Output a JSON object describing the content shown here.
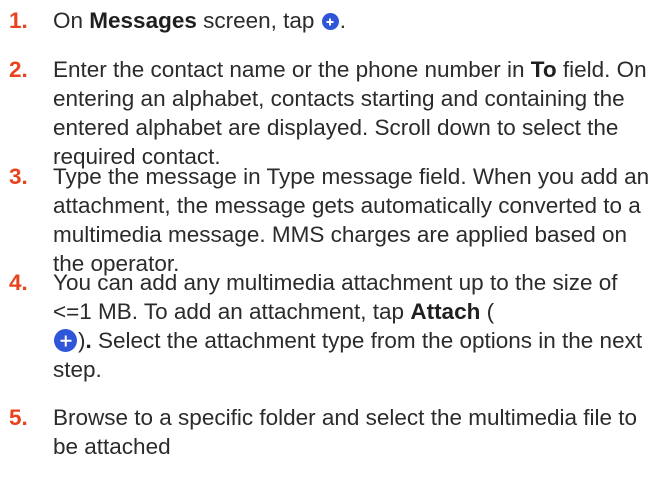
{
  "steps": [
    {
      "num": "1.",
      "a": "On ",
      "b": "Messages",
      "c": " screen, tap ",
      "d": "."
    },
    {
      "num": "2.",
      "a": "Enter the contact name or the phone number in ",
      "b": "To",
      "c": " field. On entering an alphabet, contacts starting and containing the entered alphabet are displayed. Scroll down to select the required contact."
    },
    {
      "num": "3.",
      "a": "Type the message in Type message field. When you add an attachment, the message gets automatically converted to a multimedia message. MMS charges are applied based on the operator."
    },
    {
      "num": "4.",
      "a": "You can add any multimedia attachment up to the size of <=1 MB. To add an attachment, tap ",
      "b": "Attach",
      "c": " (",
      "d": ")",
      "e": ".",
      "f": " Select the attachment type from the options in the next step."
    },
    {
      "num": "5.",
      "a": "Browse to a specific folder and select the multimedia file to be attached"
    }
  ],
  "icons": {
    "plus": "plus-circle-icon"
  },
  "colors": {
    "number": "#e8431e",
    "icon_bg": "#2f56d9"
  }
}
